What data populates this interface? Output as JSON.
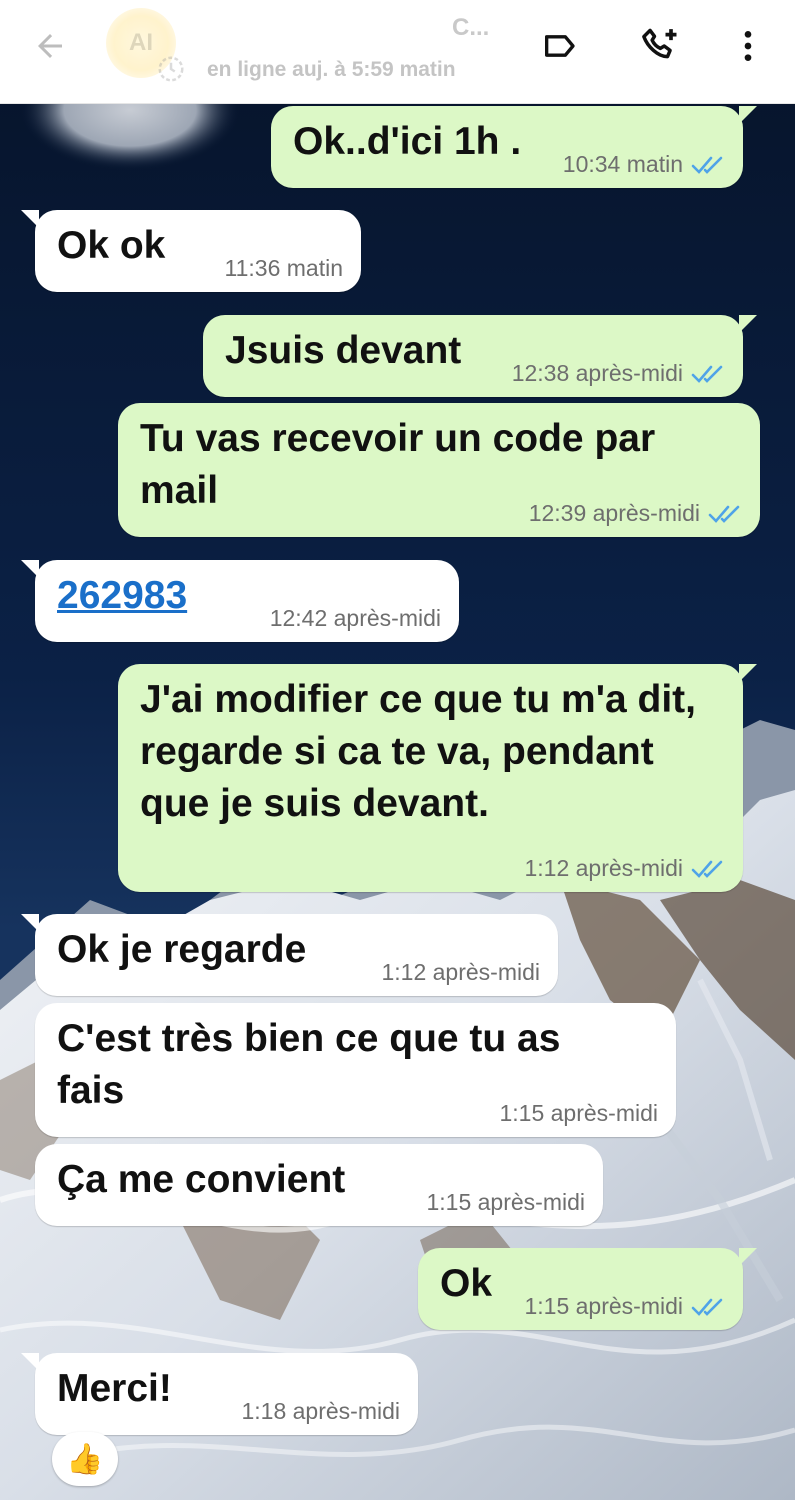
{
  "header": {
    "avatar_initials": "AI",
    "contact_name": "C...",
    "last_seen": "en ligne auj. à 5:59 matin",
    "icons": {
      "back": "arrow-left-icon",
      "label": "label-tag-icon",
      "call": "phone-add-icon",
      "menu": "more-vertical-icon"
    }
  },
  "messages": [
    {
      "direction": "out",
      "text": "Ok..d'ici 1h .",
      "time": "10:34 matin",
      "status": "read"
    },
    {
      "direction": "in",
      "text": "Ok ok",
      "time": "11:36 matin"
    },
    {
      "direction": "out",
      "text": "Jsuis devant",
      "time": "12:38 après-midi",
      "status": "read"
    },
    {
      "direction": "out",
      "text": "Tu vas recevoir un code par mail",
      "time": "12:39 après-midi",
      "status": "read"
    },
    {
      "direction": "in",
      "text": "262983",
      "time": "12:42 après-midi",
      "is_link": true
    },
    {
      "direction": "out",
      "text": "J'ai modifier ce que tu m'a dit, regarde si ca te va, pendant que je suis devant.",
      "time": "1:12 après-midi",
      "status": "read"
    },
    {
      "direction": "in",
      "text": "Ok je regarde",
      "time": "1:12 après-midi"
    },
    {
      "direction": "in",
      "text": "C'est très bien ce que tu as fais",
      "time": "1:15 après-midi"
    },
    {
      "direction": "in",
      "text": "Ça me convient",
      "time": "1:15 après-midi"
    },
    {
      "direction": "out",
      "text": "Ok",
      "time": "1:15 après-midi",
      "status": "read"
    },
    {
      "direction": "in",
      "text": "Merci!",
      "time": "1:18 après-midi"
    }
  ],
  "reaction": {
    "emoji": "👍"
  },
  "colors": {
    "outgoing_bubble": "#dcf8c6",
    "incoming_bubble": "#ffffff",
    "read_ticks": "#4fa3e8",
    "link": "#1a6fc9"
  }
}
